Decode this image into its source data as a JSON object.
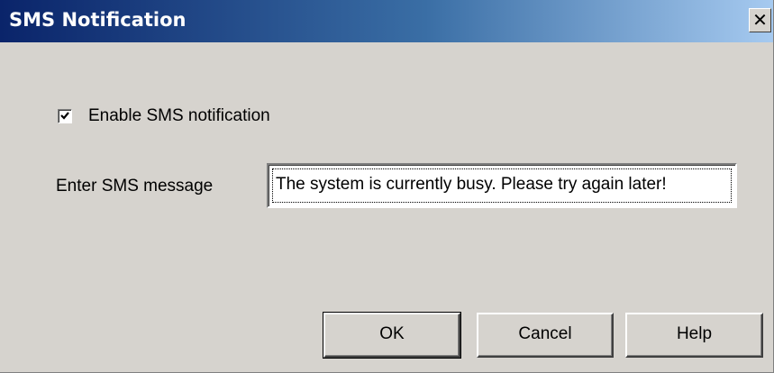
{
  "window": {
    "title": "SMS Notification",
    "close_glyph": "✕"
  },
  "form": {
    "enable_checkbox": {
      "label": "Enable SMS notification",
      "checked": true
    },
    "message": {
      "label": "Enter SMS message",
      "value": "The system is currently busy. Please try again later!"
    }
  },
  "buttons": {
    "ok": "OK",
    "cancel": "Cancel",
    "help": "Help"
  }
}
